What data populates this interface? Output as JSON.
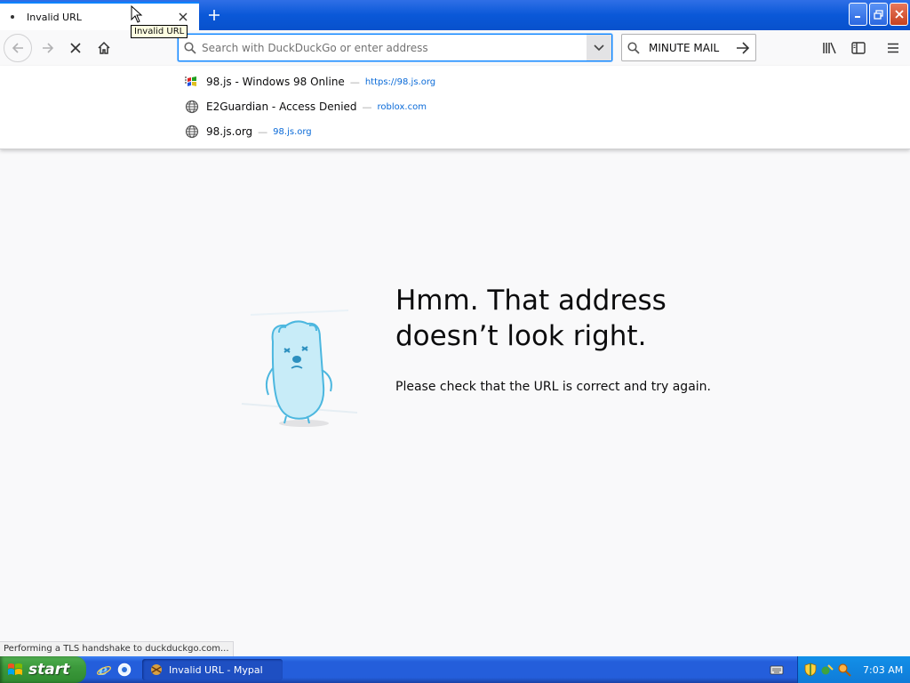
{
  "tab": {
    "title": "Invalid URL"
  },
  "tooltip": "Invalid URL",
  "urlbar": {
    "placeholder": "Search with DuckDuckGo or enter address"
  },
  "searchbar": {
    "label": "MINUTE MAIL"
  },
  "autocomplete": [
    {
      "title": "98.js - Windows 98 Online",
      "url": "https://98.js.org"
    },
    {
      "title": "E2Guardian - Access Denied",
      "url": "roblox.com"
    },
    {
      "title": "98.js.org",
      "url": "98.js.org"
    }
  ],
  "separator": "—",
  "error": {
    "title_line1": "Hmm. That address",
    "title_line2": "doesn’t look right.",
    "description": "Please check that the URL is correct and try again."
  },
  "status": "Performing a TLS handshake to duckduckgo.com...",
  "taskbar": {
    "start_label": "start",
    "task_label": "Invalid URL - Mypal",
    "clock": "7:03 AM"
  },
  "colors": {
    "accent": "#0a84ff",
    "taskbar": "#245edb",
    "start": "#3c9a3c",
    "link": "#0a6ad8"
  }
}
